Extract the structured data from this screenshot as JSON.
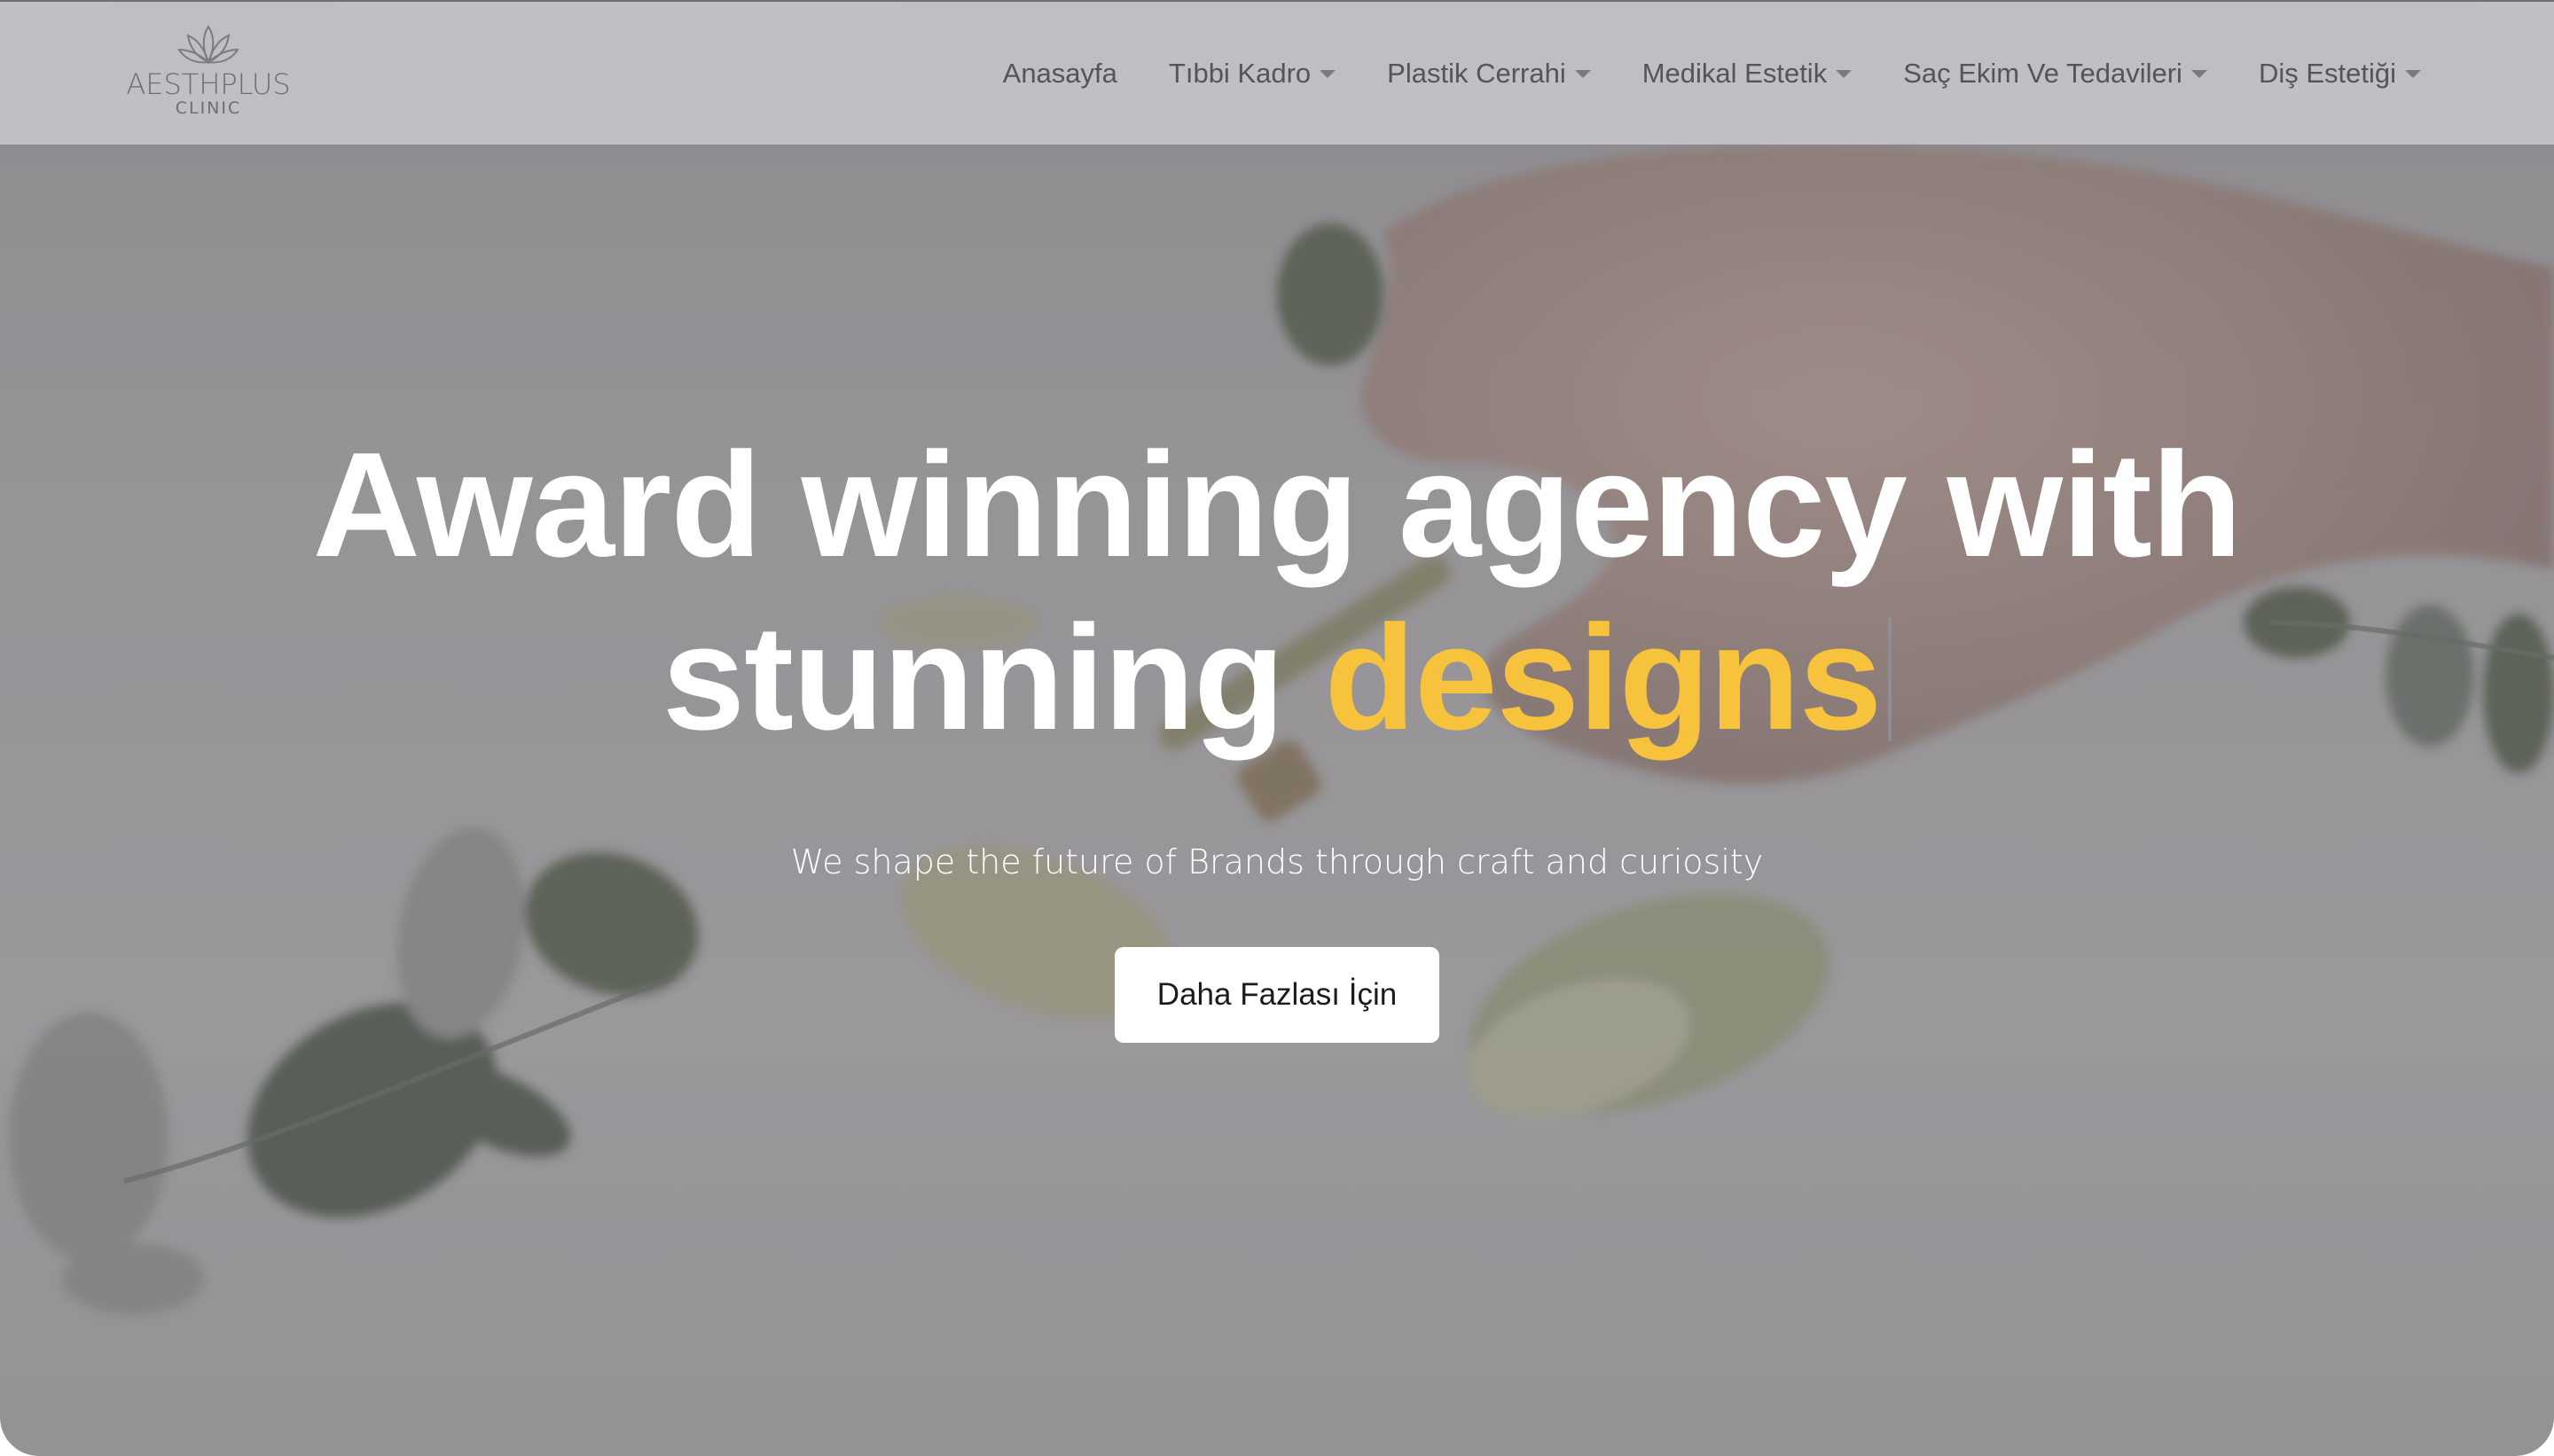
{
  "brand": {
    "name": "AESTHPLUS",
    "sub": "CLINIC",
    "logo_icon": "lotus-icon"
  },
  "nav": {
    "items": [
      {
        "label": "Anasayfa",
        "has_dropdown": false
      },
      {
        "label": "Tıbbi Kadro",
        "has_dropdown": true
      },
      {
        "label": "Plastik Cerrahi",
        "has_dropdown": true
      },
      {
        "label": "Medikal Estetik",
        "has_dropdown": true
      },
      {
        "label": "Saç Ekim Ve Tedavileri",
        "has_dropdown": true
      },
      {
        "label": "Diş Estetiği",
        "has_dropdown": true
      }
    ]
  },
  "hero": {
    "headline_line1": "Award winning agency with",
    "headline_line2_prefix": "stunning",
    "headline_highlight": "designs",
    "subtitle": "We shape the future of Brands through craft and curiosity",
    "cta_label": "Daha Fazlası İçin"
  },
  "colors": {
    "accent": "#f7c33d",
    "navbar_bg": "#c4c3c7",
    "nav_text": "#555459",
    "cta_bg": "#ffffff"
  }
}
